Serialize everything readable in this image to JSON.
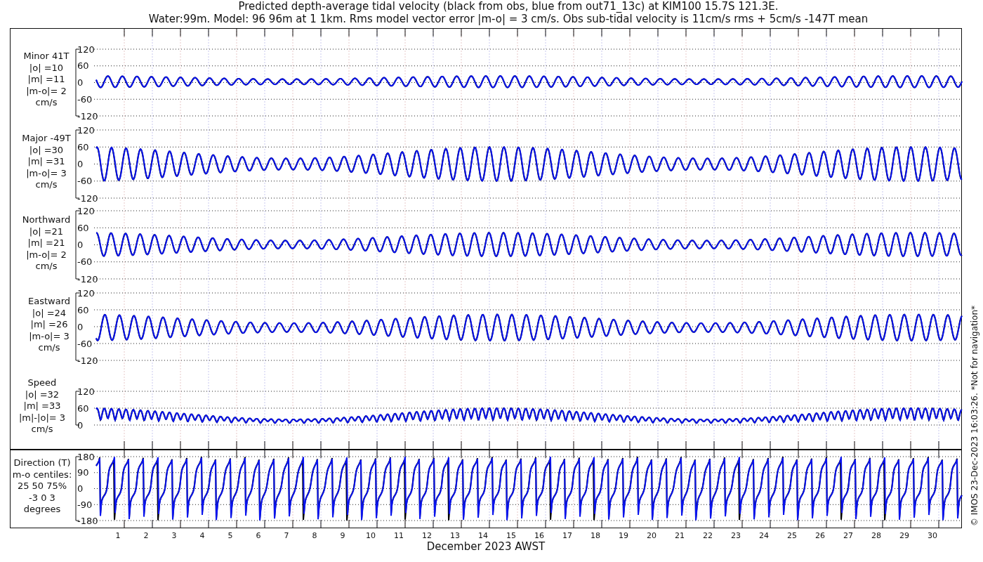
{
  "title_lines": [
    "Predicted depth-average tidal velocity (black from obs, blue from out71_13c) at KIM100 15.7S 121.3E.",
    "Water:99m. Model: 96 96m at 1 1km. Rms model vector error |m-o| = 3 cm/s. Obs sub-tidal velocity is 11cm/s rms + 5cm/s -147T mean"
  ],
  "panels": [
    {
      "kind": "minor",
      "label_lines": [
        "Minor 41T",
        "|o| =10",
        "|m| =11",
        "|m-o|= 2",
        "cm/s"
      ],
      "yticks": [
        "120",
        "60",
        "0",
        "-60",
        "-120"
      ]
    },
    {
      "kind": "major",
      "label_lines": [
        "Major -49T",
        "|o| =30",
        "|m| =31",
        "|m-o|= 3",
        "cm/s"
      ],
      "yticks": [
        "120",
        "60",
        "0",
        "-60",
        "-120"
      ]
    },
    {
      "kind": "north",
      "label_lines": [
        "Northward",
        "|o| =21",
        "|m| =21",
        "|m-o|= 2",
        "cm/s"
      ],
      "yticks": [
        "120",
        "60",
        "0",
        "-60",
        "-120"
      ]
    },
    {
      "kind": "east",
      "label_lines": [
        "Eastward",
        "|o| =24",
        "|m| =26",
        "|m-o|= 3",
        "cm/s"
      ],
      "yticks": [
        "120",
        "60",
        "0",
        "-60",
        "-120"
      ]
    },
    {
      "kind": "speed",
      "label_lines": [
        "Speed",
        "|o| =32",
        "|m| =33",
        "|m|-|o|= 3",
        "cm/s"
      ],
      "yticks": [
        "120",
        "60",
        "0"
      ]
    },
    {
      "kind": "direction",
      "label_lines": [
        "Direction (T)",
        "m-o centiles:",
        "25  50  75%",
        "-3  0  3",
        "degrees"
      ],
      "yticks": [
        "180",
        "90",
        "0",
        "-90",
        "-180"
      ]
    }
  ],
  "day_labels": [
    "1",
    "2",
    "3",
    "4",
    "5",
    "6",
    "7",
    "8",
    "9",
    "10",
    "11",
    "12",
    "13",
    "14",
    "15",
    "16",
    "17",
    "18",
    "19",
    "20",
    "21",
    "22",
    "23",
    "24",
    "25",
    "26",
    "27",
    "28",
    "29",
    "30"
  ],
  "xlabel": "December 2023 AWST",
  "credit": "© IMOS 23-Dec-2023 16:03:26.  *Not for navigation*"
}
